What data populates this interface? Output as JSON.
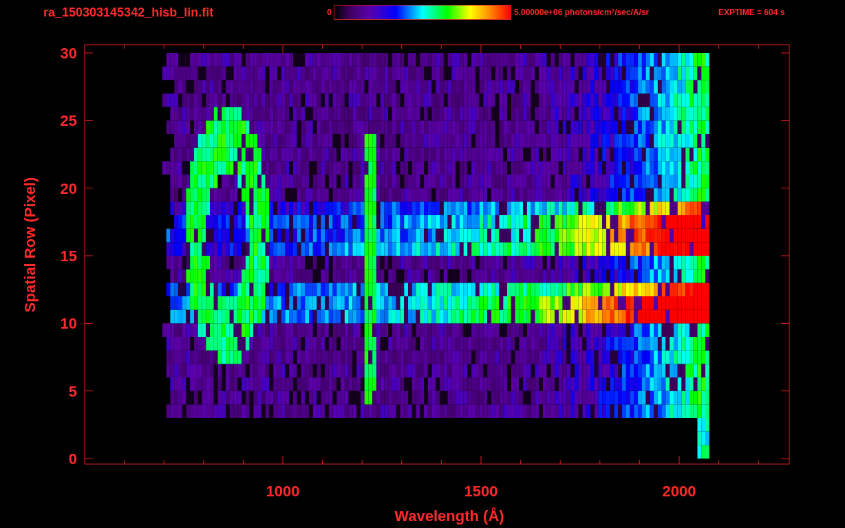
{
  "header": {
    "filename": "ra_150303145342_hisb_lin.fit",
    "colorbar": {
      "min_label": "0",
      "max_label": "5.00000e+06 photons/cm$^{2}$/sec/A/sr"
    },
    "exposure": "EXPTIME = 604 s"
  },
  "plot": {
    "xlabel": "Wavelength (Å)",
    "ylabel": "Spatial Row (Pixel)",
    "xticks": [
      "1000",
      "1500",
      "2000"
    ],
    "yticks": [
      "30",
      "25",
      "20",
      "15",
      "10",
      "5",
      "0"
    ]
  }
}
